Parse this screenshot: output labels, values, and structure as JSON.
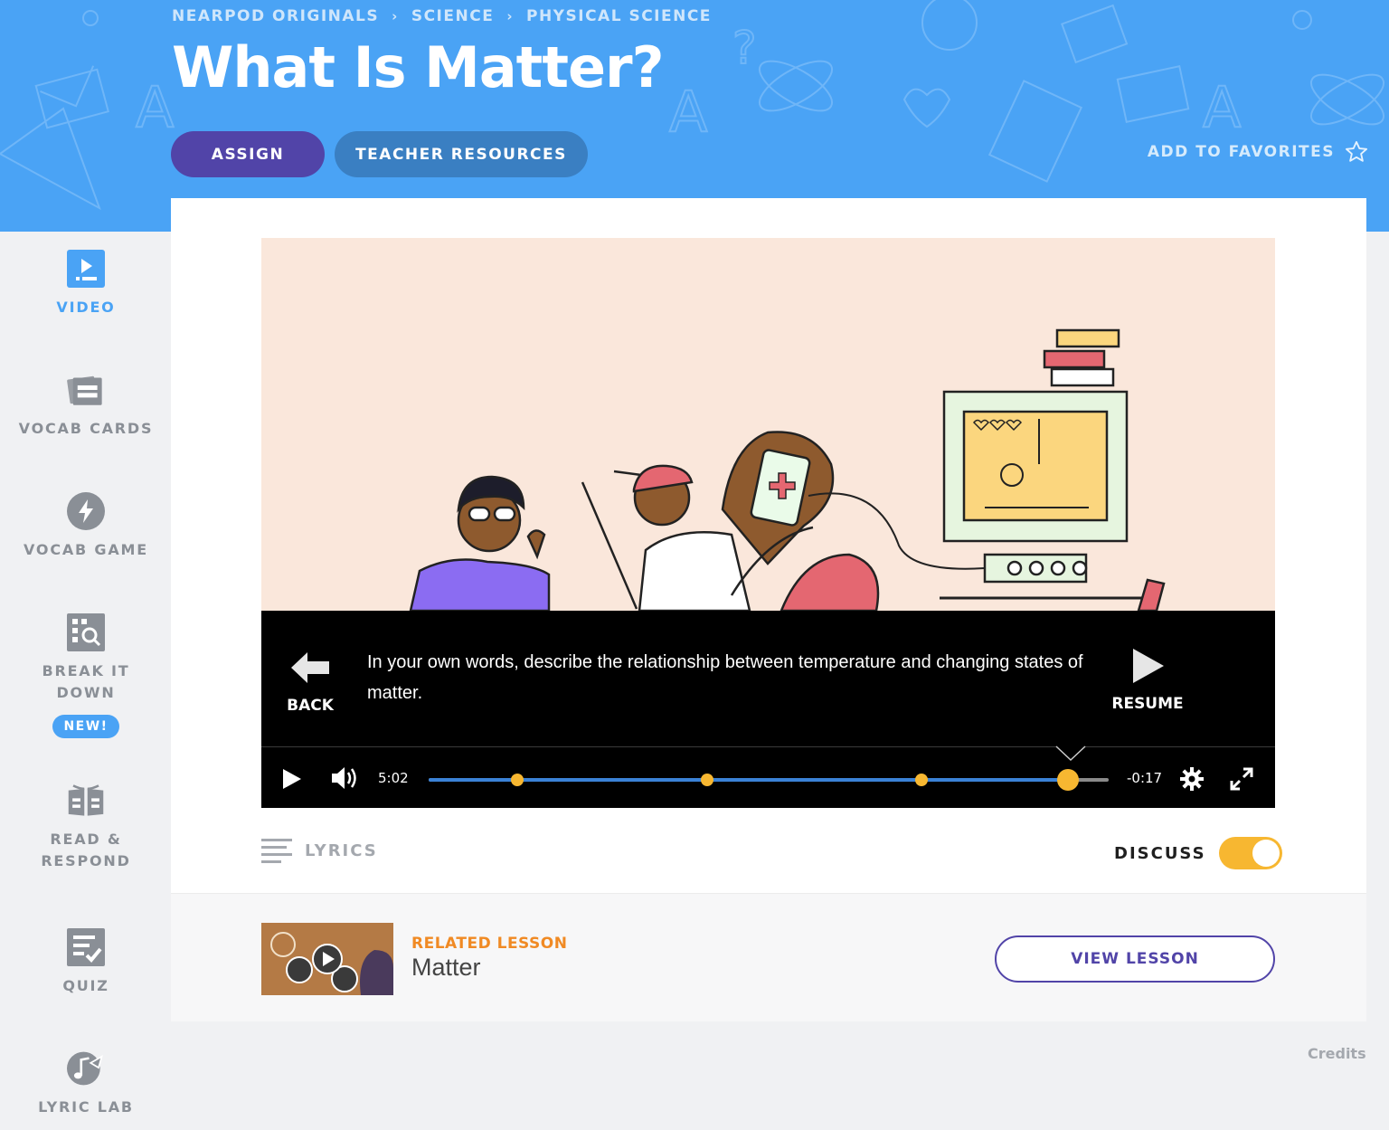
{
  "breadcrumb": {
    "items": [
      "NEARPOD ORIGINALS",
      "SCIENCE",
      "PHYSICAL SCIENCE"
    ]
  },
  "header": {
    "title": "What Is Matter?",
    "assign_label": "ASSIGN",
    "resources_label": "TEACHER RESOURCES",
    "favorites_label": "ADD TO FAVORITES"
  },
  "sidebar": {
    "items": [
      {
        "label": "VIDEO",
        "icon": "video-icon",
        "active": true
      },
      {
        "label": "VOCAB CARDS",
        "icon": "vocab-cards-icon"
      },
      {
        "label": "VOCAB GAME",
        "icon": "lightning-icon"
      },
      {
        "label": "BREAK IT DOWN",
        "icon": "magnify-grid-icon",
        "badge": "NEW!"
      },
      {
        "label": "READ & RESPOND",
        "icon": "open-book-icon"
      },
      {
        "label": "QUIZ",
        "icon": "checklist-icon"
      },
      {
        "label": "LYRIC LAB",
        "icon": "music-note-icon"
      }
    ]
  },
  "video": {
    "question": "In your own words, describe the relationship between temperature and changing states of matter.",
    "back_label": "BACK",
    "resume_label": "RESUME",
    "time_elapsed": "5:02",
    "time_remaining": "-0:17",
    "progress": 0.94,
    "markers": [
      0.13,
      0.41,
      0.725
    ]
  },
  "lyrics_label": "LYRICS",
  "discuss": {
    "label": "DISCUSS",
    "on": true
  },
  "related": {
    "label": "RELATED LESSON",
    "title": "Matter",
    "button_label": "VIEW LESSON"
  },
  "credits_label": "Credits",
  "colors": {
    "header_blue": "#4aa3f5",
    "assign_purple": "#5144a8",
    "accent_yellow": "#f7b731",
    "related_orange": "#f08a24"
  }
}
